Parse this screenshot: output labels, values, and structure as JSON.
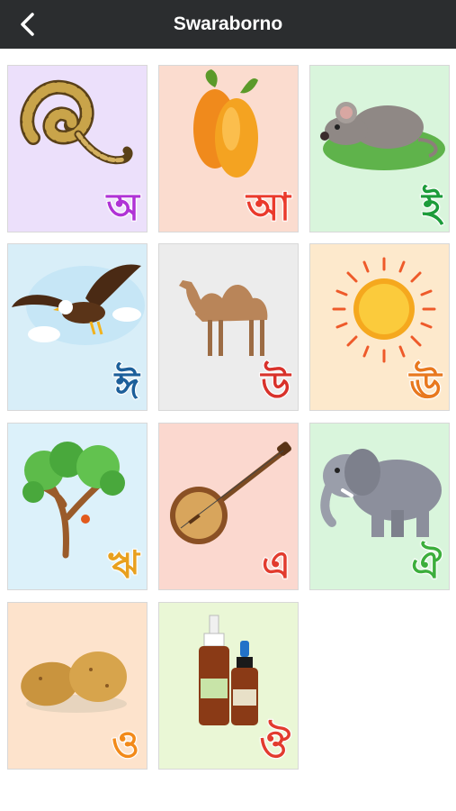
{
  "header": {
    "title": "Swaraborno",
    "back_icon": "chevron-left-icon"
  },
  "cards": [
    {
      "letter": "অ",
      "picture": "snake",
      "bg": "#ece0fb",
      "letter_color": "#b033d6"
    },
    {
      "letter": "আ",
      "picture": "mango",
      "bg": "#fbdccf",
      "letter_color": "#ea3a2c"
    },
    {
      "letter": "ই",
      "picture": "mouse",
      "bg": "#d9f5dc",
      "letter_color": "#1c9c3a"
    },
    {
      "letter": "ঈ",
      "picture": "eagle",
      "bg": "#d8eef8",
      "letter_color": "#1c5f9a"
    },
    {
      "letter": "উ",
      "picture": "camel",
      "bg": "#ececec",
      "letter_color": "#d8322b"
    },
    {
      "letter": "ঊ",
      "picture": "sun",
      "bg": "#fde9cc",
      "letter_color": "#e8781e"
    },
    {
      "letter": "ঋ",
      "picture": "tree",
      "bg": "#dcf1fa",
      "letter_color": "#e8a01e"
    },
    {
      "letter": "এ",
      "picture": "banjo",
      "bg": "#fbd8cf",
      "letter_color": "#e23b2e"
    },
    {
      "letter": "ঐ",
      "picture": "elephant",
      "bg": "#d9f5dc",
      "letter_color": "#3cae3c"
    },
    {
      "letter": "ও",
      "picture": "potato",
      "bg": "#fde3cc",
      "letter_color": "#f28a1a"
    },
    {
      "letter": "ঔ",
      "picture": "bottles",
      "bg": "#eaf7d6",
      "letter_color": "#e23b2e"
    }
  ]
}
